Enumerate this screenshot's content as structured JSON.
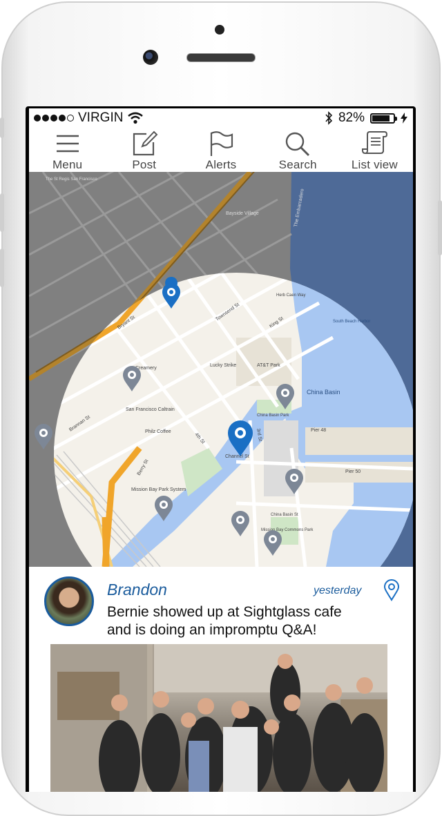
{
  "status": {
    "carrier": "VIRGIN",
    "battery": "82%",
    "signal_bars_filled": 4,
    "signal_bars_total": 5,
    "battery_level": 0.82
  },
  "toolbar": {
    "items": [
      {
        "label": "Menu",
        "icon": "hamburger-icon"
      },
      {
        "label": "Post",
        "icon": "compose-icon"
      },
      {
        "label": "Alerts",
        "icon": "flag-icon"
      },
      {
        "label": "Search",
        "icon": "search-icon"
      },
      {
        "label": "List view",
        "icon": "scroll-list-icon"
      }
    ]
  },
  "map": {
    "labels": {
      "china_basin": "China Basin",
      "att_park": "AT&T Park",
      "lucky_strike": "Lucky Strike",
      "sf_caltrain": "San Francisco Caltrain",
      "philz": "Philz Coffee",
      "mission_bay_park": "Mission Bay Park System",
      "channel_st": "Channel St",
      "china_basin_park": "China Basin Park",
      "mission_bay_commons": "Mission Bay Commons Park",
      "herb_caen": "Herb Caen Way",
      "south_beach": "South Beach Harbor",
      "bayside": "Bayside Village",
      "embarcadero": "The Embarcadero",
      "pier_50": "Pier 50",
      "pier_48": "Pier 48",
      "st_regis": "The St Regis San Francisco",
      "creamery": "Creamery",
      "townsend": "Townsend St",
      "king": "King St",
      "brannan": "Brannan St",
      "bryant": "Bryant St",
      "third": "3rd St",
      "fourth": "4th St",
      "berry": "Berry St",
      "china_basin_st": "China Basin St"
    },
    "colors": {
      "water": "#3f75c9",
      "radius": "#9fc3ef",
      "pin_active": "#1a6fc4",
      "pin": "#7d8796",
      "freeway": "#f0a52a"
    }
  },
  "post": {
    "author": "Brandon",
    "time": "yesterday",
    "text_line1": "Bernie showed up at Sightglass cafe",
    "text_line2": "and is doing an impromptu Q&A!",
    "location_icon": "location-pin-icon"
  }
}
